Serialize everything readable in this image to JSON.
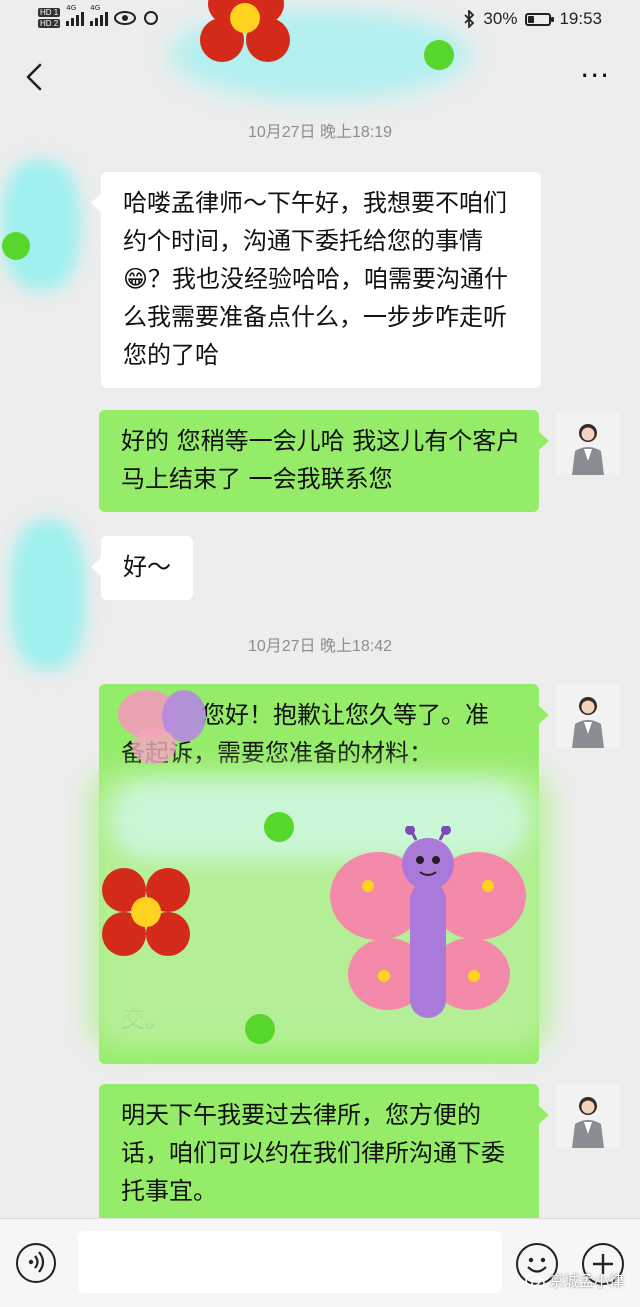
{
  "status_bar": {
    "sim1": "HD 1",
    "sim2": "HD 2",
    "network1": "4G",
    "network2": "4G",
    "battery_percent": "30%",
    "battery_level": 0.3,
    "time": "19:53"
  },
  "nav": {
    "back_icon": "chevron-left-icon",
    "more_icon": "more-icon",
    "more_glyph": "···"
  },
  "messages": [
    {
      "type": "time",
      "text": "10月27日 晚上18:19"
    },
    {
      "type": "incoming",
      "text": "哈喽孟律师～下午好，我想要不咱们约个时间，沟通下委托给您的事情😁？我也没经验哈哈，咱需要沟通什么我需要准备点什么，一步步咋走听您的了哈"
    },
    {
      "type": "outgoing",
      "text": "好的 您稍等一会儿哈 我这儿有个客户马上结束了 一会我联系您"
    },
    {
      "type": "incoming",
      "text": "好～"
    },
    {
      "type": "time",
      "text": "10月27日 晚上18:42"
    },
    {
      "type": "outgoing",
      "text_line1": "您好！抱歉让您久等了。准",
      "text_line2": "备起诉，需要您准备的材料：",
      "text_end": "交。"
    },
    {
      "type": "outgoing",
      "text": "明天下午我要过去律所，您方便的话，咱们可以约在我们律所沟通下委托事宜。"
    }
  ],
  "input_bar": {
    "voice_icon": "voice-icon",
    "input_value": "",
    "emoji_icon": "emoji-icon",
    "plus_icon": "plus-icon"
  },
  "watermark": "京城孟小律",
  "colors": {
    "background": "#ededed",
    "incoming_bubble": "#ffffff",
    "outgoing_bubble": "#95ec69",
    "timestamp": "#8e8e8e"
  }
}
